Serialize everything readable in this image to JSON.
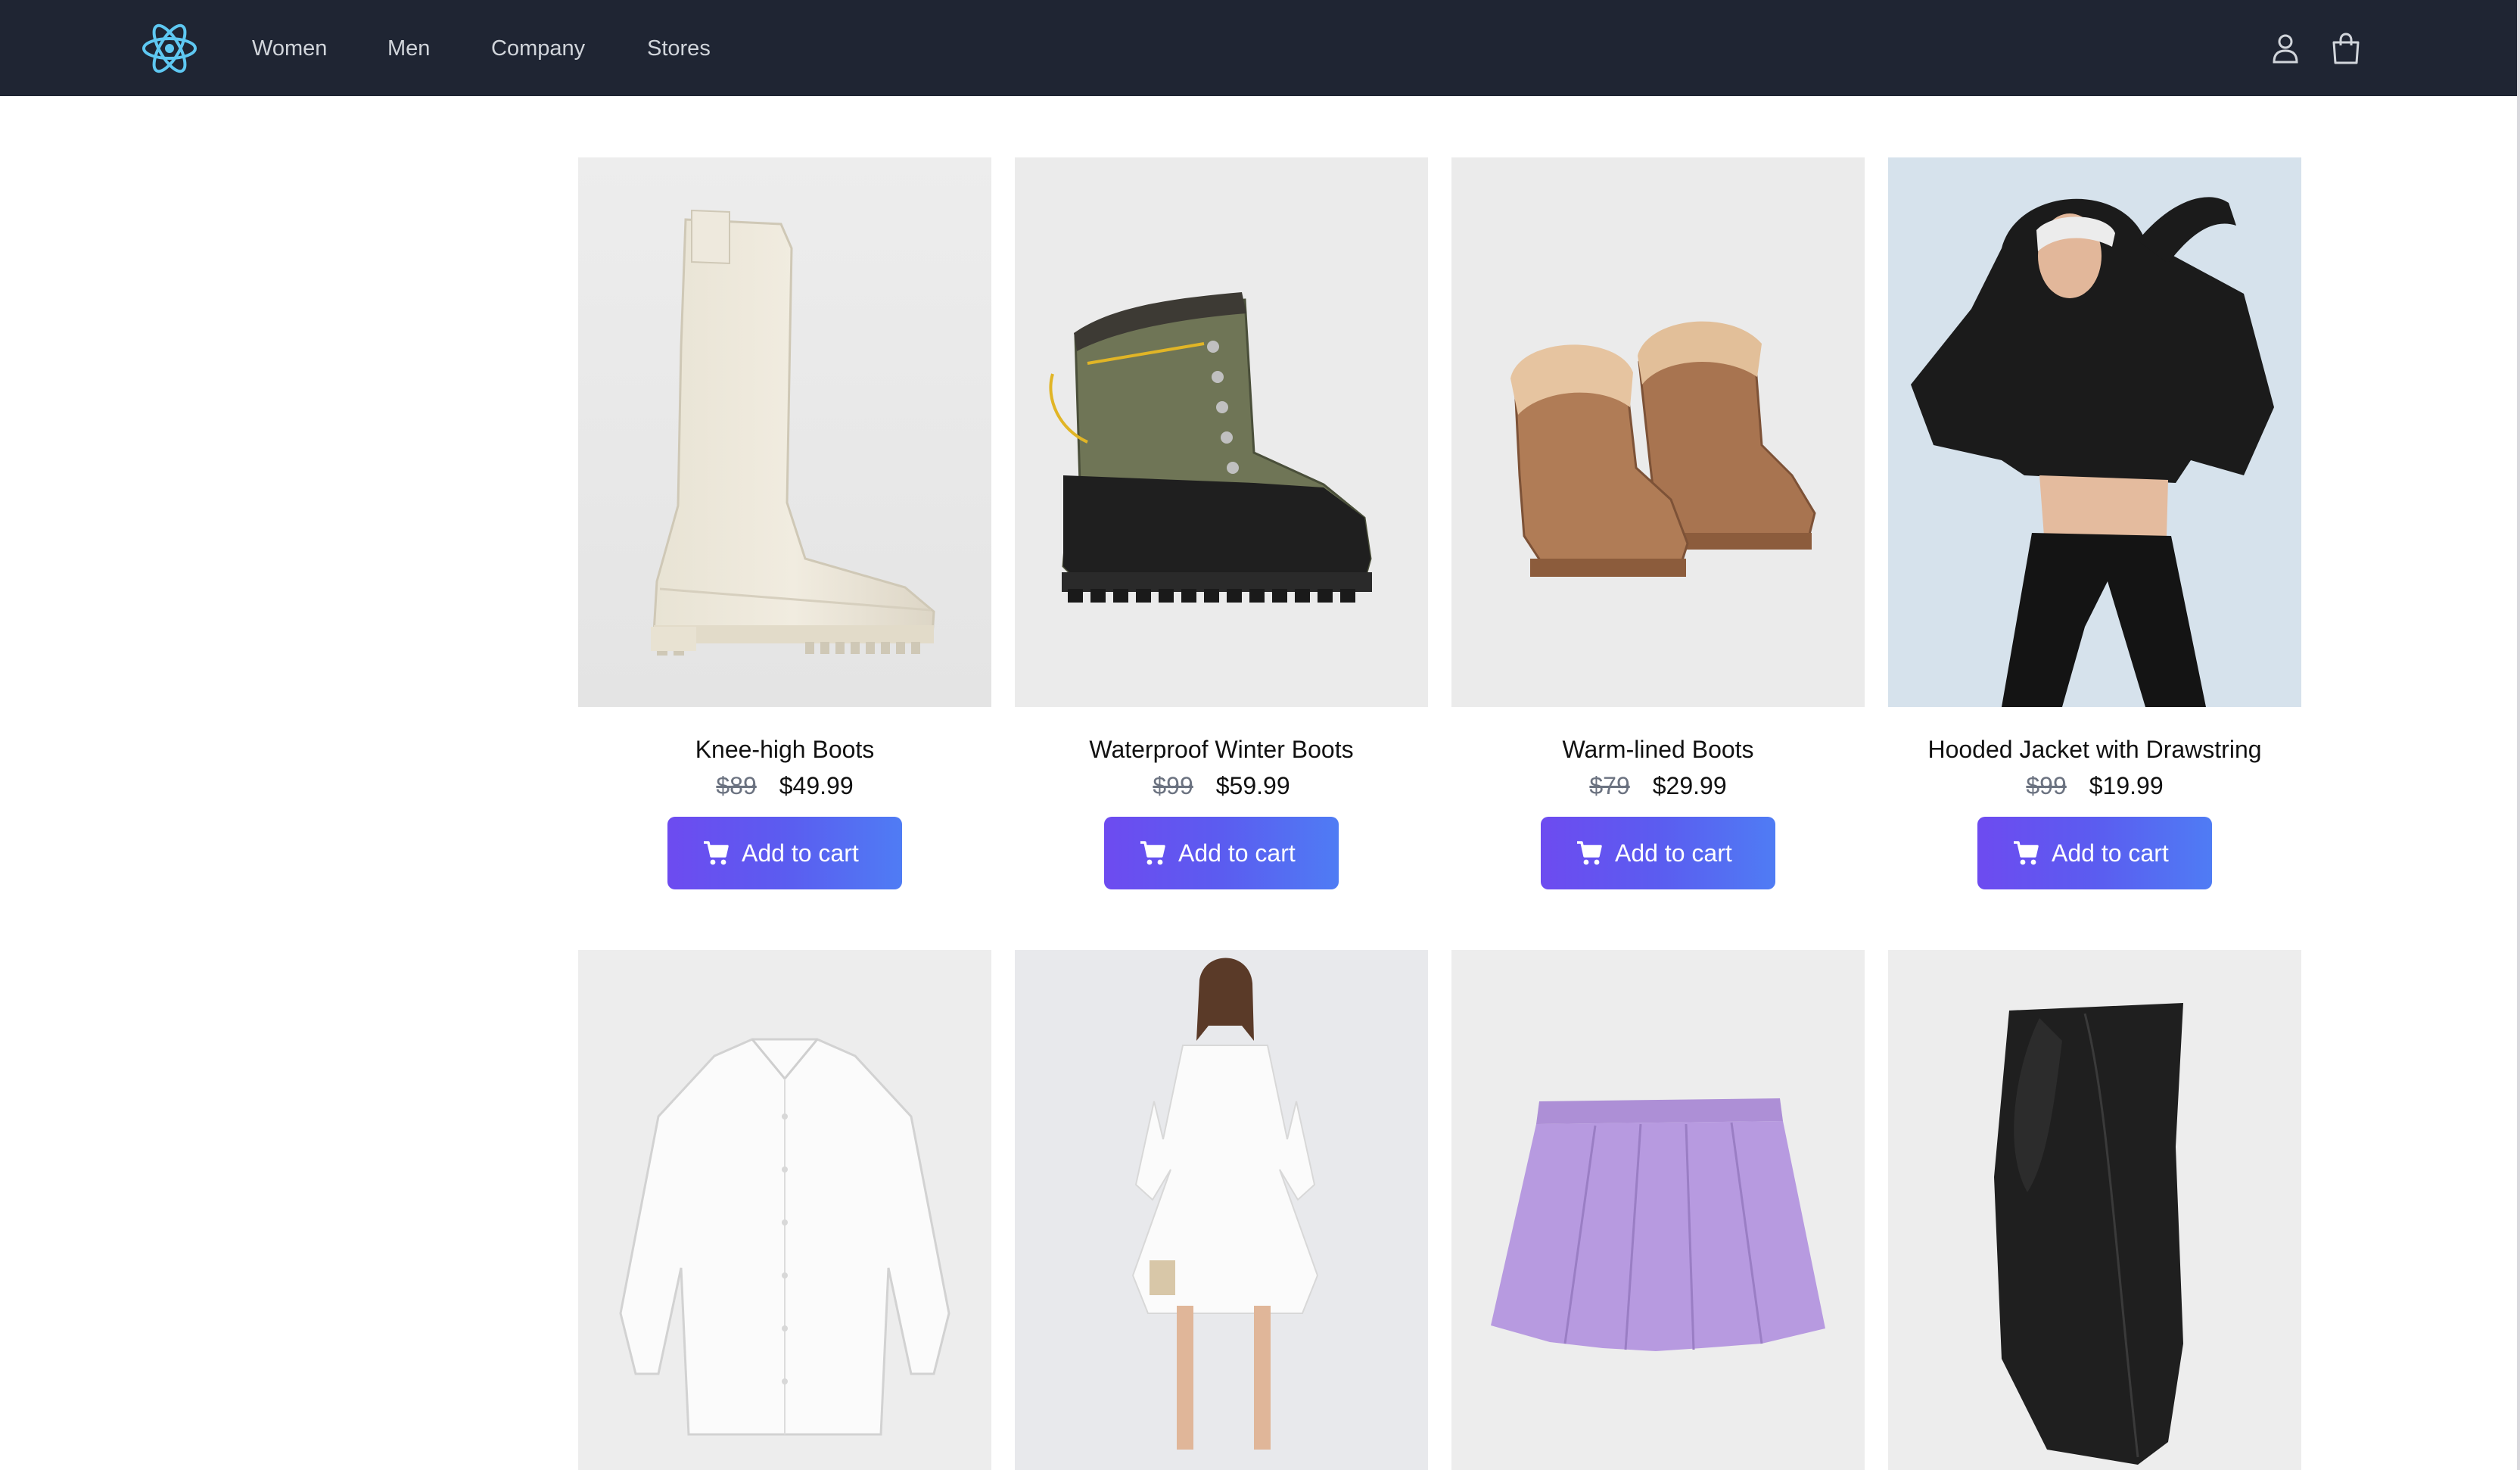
{
  "nav": {
    "links": [
      "Women",
      "Men",
      "Company",
      "Stores"
    ]
  },
  "colors": {
    "navbar": "#1f2533",
    "logo": "#5ec8f2",
    "button_start": "#6d4bf0",
    "button_end": "#4f7cf4"
  },
  "icons": {
    "logo": "react-atom-icon",
    "account": "user-icon",
    "cart": "shopping-bag-icon",
    "add_to_cart": "shopping-cart-icon"
  },
  "products": [
    {
      "title": "Knee-high Boots",
      "old_price": "$89",
      "price": "$49.99",
      "button": "Add to cart"
    },
    {
      "title": "Waterproof Winter Boots",
      "old_price": "$99",
      "price": "$59.99",
      "button": "Add to cart"
    },
    {
      "title": "Warm-lined Boots",
      "old_price": "$79",
      "price": "$29.99",
      "button": "Add to cart"
    },
    {
      "title": "Hooded Jacket with Drawstring",
      "old_price": "$99",
      "price": "$19.99",
      "button": "Add to cart"
    },
    {
      "title": "",
      "old_price": "",
      "price": "",
      "button": ""
    },
    {
      "title": "",
      "old_price": "",
      "price": "",
      "button": ""
    },
    {
      "title": "",
      "old_price": "",
      "price": "",
      "button": ""
    },
    {
      "title": "",
      "old_price": "",
      "price": "",
      "button": ""
    }
  ]
}
